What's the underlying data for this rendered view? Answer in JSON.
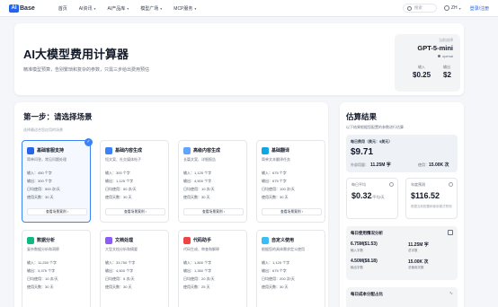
{
  "nav": {
    "logo_mark": "AI",
    "logo_text": "Base",
    "items": [
      {
        "label": "首页",
        "has_dropdown": false
      },
      {
        "label": "AI资讯",
        "has_dropdown": true
      },
      {
        "label": "AI产品库",
        "has_dropdown": true
      },
      {
        "label": "模型广场",
        "has_dropdown": true
      },
      {
        "label": "MCP服务",
        "has_dropdown": true
      }
    ],
    "search_placeholder": "搜索",
    "lang": "ZH",
    "login": "登录/注册"
  },
  "hero": {
    "title": "AI大模型费用计算器",
    "subtitle": "精准模型预算，告别繁琐和复杂的参数，只需三步给出费用预估",
    "model": {
      "label": "当前选择",
      "name": "GPT-5-mini",
      "provider": "openai",
      "input_label": "输入",
      "output_label": "输出",
      "input_price": "$0.25",
      "output_price": "$2"
    }
  },
  "step1": {
    "title": "第一步：请选择场景",
    "subtitle": "选择最适合您应用的场景",
    "cards": [
      {
        "title": "基础客服支持",
        "desc": "简单问答，常见问题处理",
        "color": "#2563eb",
        "selected": true,
        "input": "输入：450 个字",
        "output": "输出：300 个字",
        "daily": "日均使用：500 次/天",
        "days": "使用天数：30 天",
        "button": "查看场景案例"
      },
      {
        "title": "基础内容生成",
        "desc": "短文案、社交媒体帖子",
        "color": "#3b82f6",
        "selected": false,
        "input": "输入：300 个字",
        "output": "输出：1,125 个字",
        "daily": "日均使用：50 次/天",
        "days": "使用天数：30 天",
        "button": "查看场景案例"
      },
      {
        "title": "高级内容生成",
        "desc": "长篇文案、详细报告",
        "color": "#60a5fa",
        "selected": false,
        "input": "输入：1,125 个字",
        "output": "输出：4,500 个字",
        "daily": "日均使用：10 次/天",
        "days": "使用天数：30 天",
        "button": "查看场景案例"
      },
      {
        "title": "基础翻译",
        "desc": "简单文本翻译任务",
        "color": "#0ea5e9",
        "selected": false,
        "input": "输入：675 个字",
        "output": "输出：675 个字",
        "daily": "日均使用：100 次/天",
        "days": "使用天数：30 天",
        "button": "查看场景案例"
      },
      {
        "title": "数据分析",
        "desc": "复杂数据分析和洞察",
        "color": "#10b981",
        "selected": false,
        "input": "输入：11,250 个字",
        "output": "输出：3,375 个字",
        "daily": "日均使用：10 次/天",
        "days": "使用天数：30 天",
        "button": ""
      },
      {
        "title": "文档处理",
        "desc": "大型文档分析和摘要",
        "color": "#8b5cf6",
        "selected": false,
        "input": "输入：33,750 个字",
        "output": "输出：4,500 个字",
        "daily": "日均使用：5 次/天",
        "days": "使用天数：30 天",
        "button": ""
      },
      {
        "title": "代码助手",
        "desc": "代码生成、审查和解释",
        "color": "#ef4444",
        "selected": false,
        "input": "输入：1,800 个字",
        "output": "输出：1,350 个字",
        "daily": "日均使用：20 次/天",
        "days": "使用天数：25 天",
        "button": ""
      },
      {
        "title": "自定义使用",
        "desc": "根据您的具体需求定义使用",
        "color": "#38bdf8",
        "selected": false,
        "input": "输入：1,125 个字",
        "output": "输出：675 个字",
        "daily": "日均使用：200 次/天",
        "days": "使用天数：30 天",
        "button": ""
      }
    ]
  },
  "results": {
    "title": "估算结果",
    "subtitle": "以下结果根据您配置的参数进行估算",
    "daily_label": "每日费用（美元：$美元）",
    "daily_value": "$9.71",
    "token_label": "外部用量：",
    "token_value": "11.25M 字",
    "usage_label": "使用：",
    "usage_value": "15.00K 次",
    "monthly_label": "每日平均",
    "monthly_value": "$0.32",
    "monthly_unit": "/平均/天",
    "yearly_label": "年度预测",
    "yearly_value": "$116.52",
    "yearly_note": "根据当前配置和使用模式预测",
    "stats_title": "每日使用情况分析",
    "stats": [
      {
        "value": "6.75M($1.53)",
        "label": "输入字数"
      },
      {
        "value": "11.25M 字",
        "label": "总字数"
      },
      {
        "value": "4.50M($8.18)",
        "label": "输出字数"
      },
      {
        "value": "15.00K 次",
        "label": "总使用次数"
      }
    ],
    "breakdown_title": "每日成本分配占比"
  },
  "colors": {
    "accent": "#2563eb",
    "bg": "#f4f6fa"
  }
}
